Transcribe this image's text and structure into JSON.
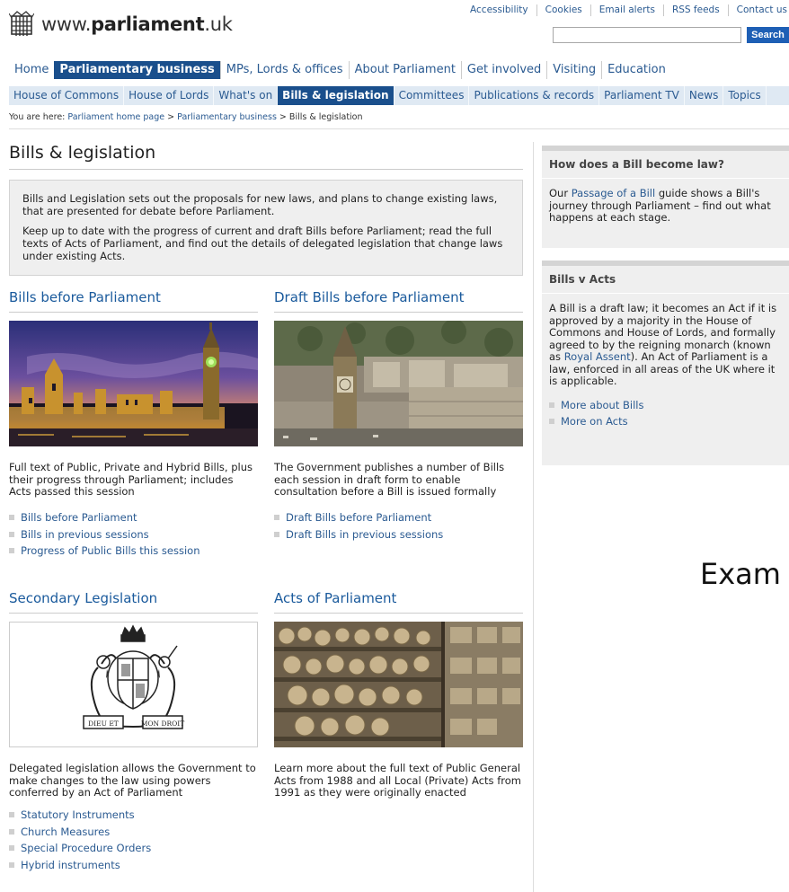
{
  "header": {
    "site_name_prefix": "www.",
    "site_name_bold": "parliament",
    "site_name_suffix": ".uk",
    "logo_icon": "portcullis-icon",
    "utility_links": [
      "Accessibility",
      "Cookies",
      "Email alerts",
      "RSS feeds",
      "Contact us"
    ],
    "search": {
      "value": "",
      "button_label": "Search"
    }
  },
  "nav_primary": [
    {
      "label": "Home",
      "active": false
    },
    {
      "label": "Parliamentary business",
      "active": true
    },
    {
      "label": "MPs, Lords & offices",
      "active": false
    },
    {
      "label": "About Parliament",
      "active": false
    },
    {
      "label": "Get involved",
      "active": false
    },
    {
      "label": "Visiting",
      "active": false
    },
    {
      "label": "Education",
      "active": false
    }
  ],
  "nav_secondary": [
    {
      "label": "House of Commons",
      "active": false
    },
    {
      "label": "House of Lords",
      "active": false
    },
    {
      "label": "What's on",
      "active": false
    },
    {
      "label": "Bills & legislation",
      "active": true
    },
    {
      "label": "Committees",
      "active": false
    },
    {
      "label": "Publications & records",
      "active": false
    },
    {
      "label": "Parliament TV",
      "active": false
    },
    {
      "label": "News",
      "active": false
    },
    {
      "label": "Topics",
      "active": false
    }
  ],
  "breadcrumb": {
    "prefix": "You are here:",
    "items": [
      "Parliament home page",
      "Parliamentary business"
    ],
    "separator": ">",
    "current": "Bills & legislation"
  },
  "page": {
    "title": "Bills & legislation",
    "intro_p1": "Bills and Legislation sets out the proposals for new laws, and plans to change existing laws, that are presented for debate before Parliament.",
    "intro_p2": "Keep up to date with the progress of current and draft Bills before Parliament; read the full texts of Acts of Parliament, and find out the details of delegated legislation that change laws under existing Acts."
  },
  "sections": {
    "bills": {
      "title": "Bills before Parliament",
      "description": "Full text of Public, Private and Hybrid Bills, plus their progress through Parliament; includes Acts passed this session",
      "links": [
        "Bills before Parliament",
        "Bills in previous sessions",
        "Progress of Public Bills this session"
      ]
    },
    "draft": {
      "title": "Draft Bills before Parliament",
      "description": "The Government publishes a number of Bills each session in draft form to enable consultation before a Bill is issued formally",
      "links": [
        "Draft Bills before Parliament",
        "Draft Bills in previous sessions"
      ]
    },
    "secondary": {
      "title": "Secondary Legislation",
      "description": "Delegated legislation allows the Government to make changes to the law using powers conferred by an Act of Parliament",
      "links": [
        "Statutory Instruments",
        "Church Measures",
        "Special Procedure Orders",
        "Hybrid instruments"
      ],
      "crest_motto_left": "DIEU ET",
      "crest_motto_right": "MON DROIT"
    },
    "acts": {
      "title": "Acts of Parliament",
      "description": "Learn more about the full text of Public General Acts from 1988 and all Local (Private) Acts from 1991 as they were originally enacted"
    }
  },
  "sidebar": {
    "box1": {
      "title": "How does a Bill become law?",
      "text_before": "Our ",
      "link": "Passage of a Bill",
      "text_after": " guide shows a Bill's journey through Parliament – find out what happens at each stage."
    },
    "box2": {
      "title": "Bills v Acts",
      "text_before": "A Bill is a draft law; it becomes an Act if it is approved by a majority in the House of Commons and House of Lords, and formally agreed to by the reigning monarch (known as ",
      "link": "Royal Assent",
      "text_after": "). An Act of Parliament is a law, enforced in all areas of the UK where it is applicable.",
      "links": [
        "More about Bills",
        "More on Acts"
      ]
    }
  },
  "overlay_text": "Exam",
  "colors": {
    "brand_blue": "#1a4f8c",
    "link_blue": "#2a5a91",
    "search_blue": "#1e5fb5",
    "nav2_bg": "#dfe9f3"
  }
}
